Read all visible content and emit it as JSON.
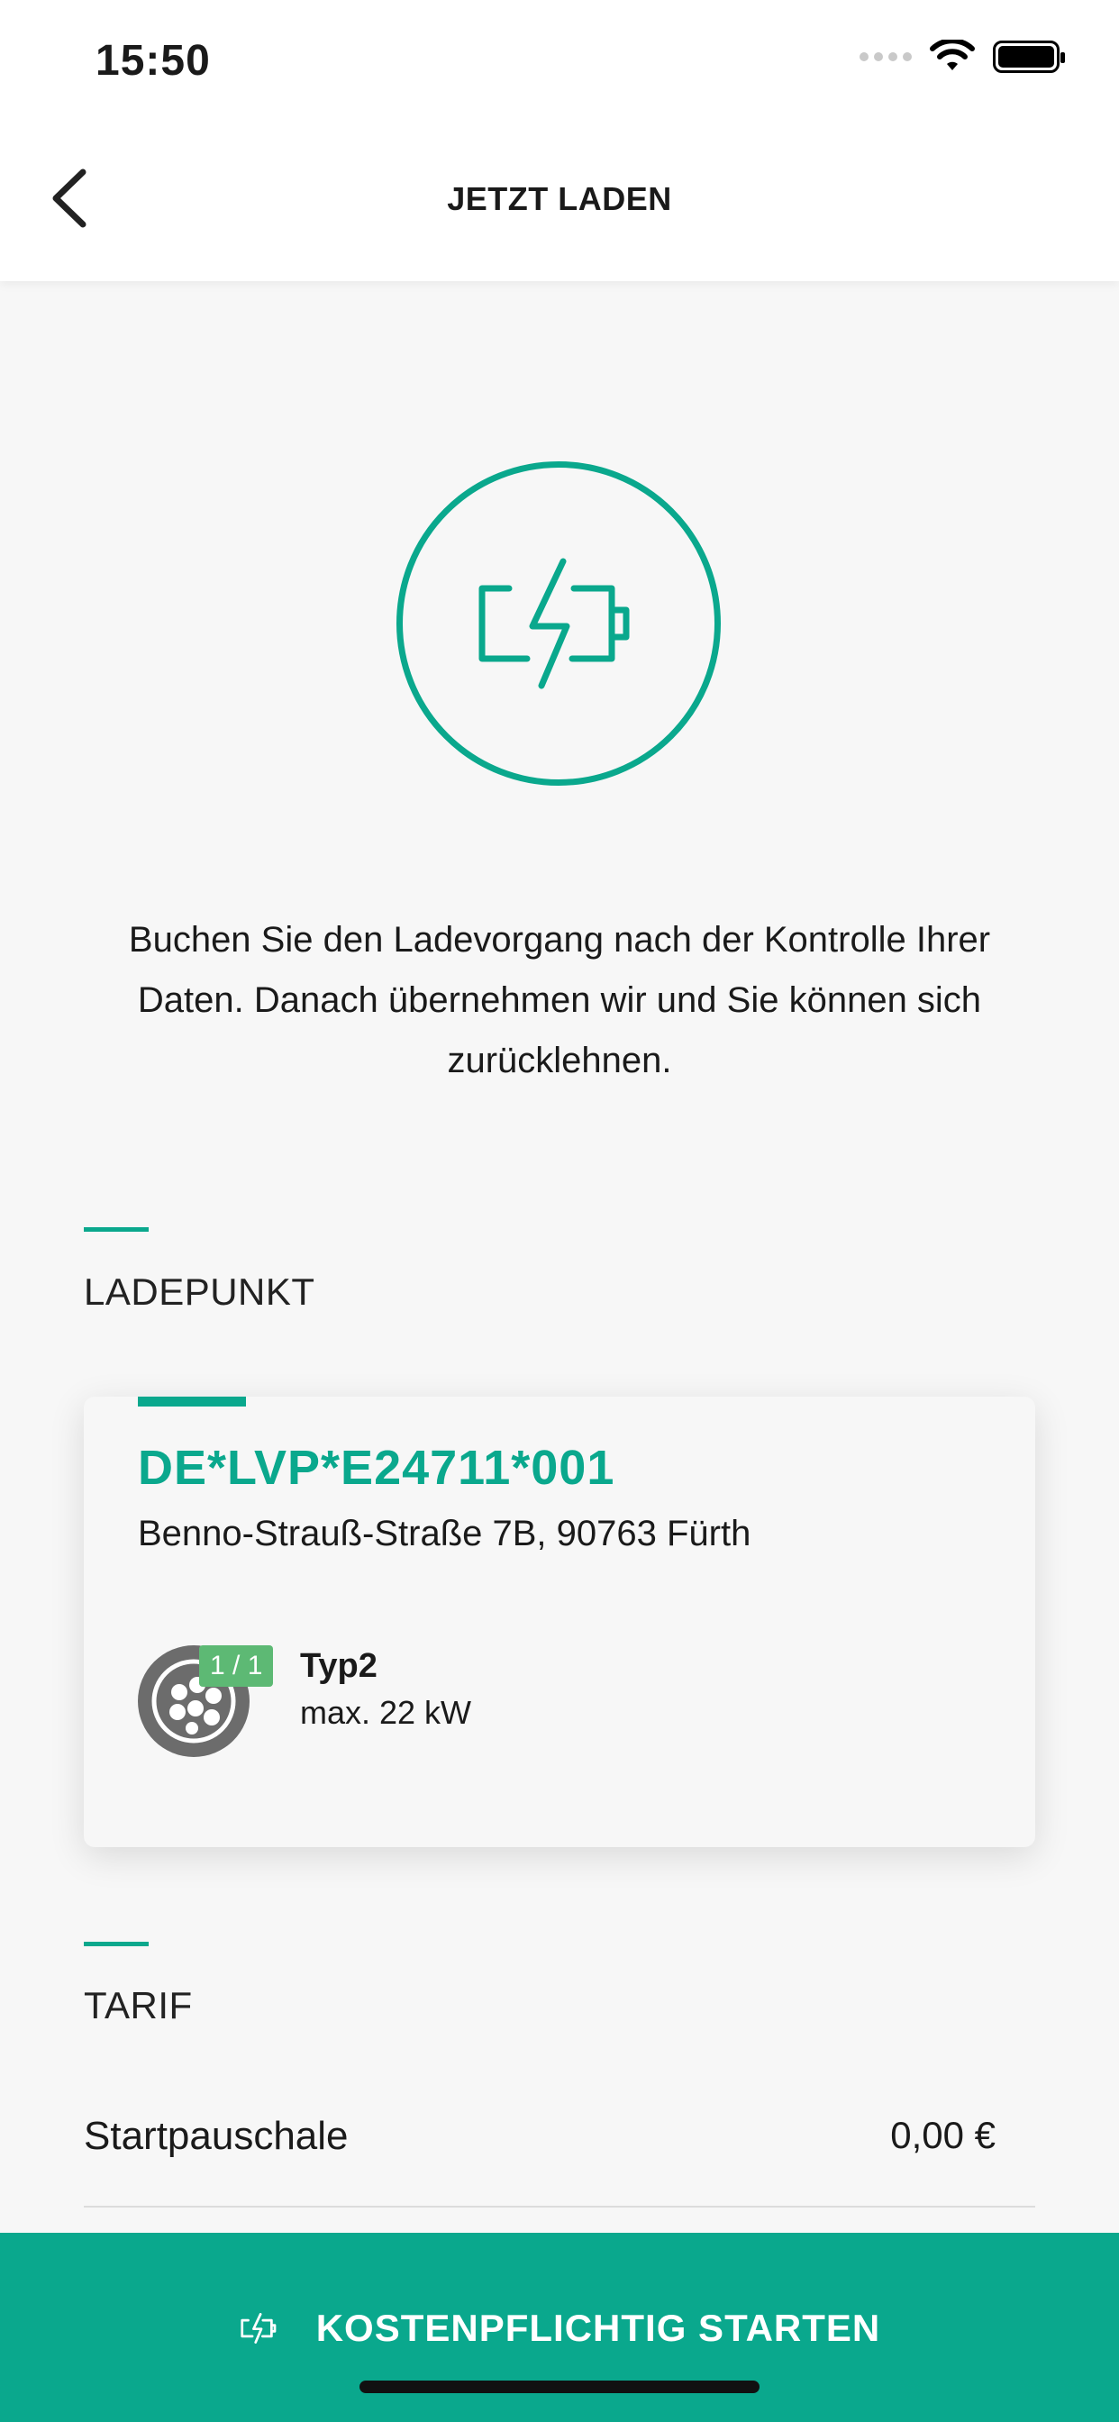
{
  "status_bar": {
    "time": "15:50"
  },
  "header": {
    "title": "JETZT LADEN"
  },
  "intro": {
    "text": "Buchen Sie den Ladevorgang nach der Kontrolle Ihrer Daten. Danach übernehmen wir und Sie können sich zurücklehnen."
  },
  "ladepunkt": {
    "section_label": "LADEPUNKT",
    "station_id": "DE*LVP*E24711*001",
    "address": "Benno-Strauß-Straße 7B, 90763 Fürth",
    "plug": {
      "badge": "1 / 1",
      "type": "Typ2",
      "power": "max. 22 kW"
    }
  },
  "tarif": {
    "section_label": "TARIF",
    "rows": [
      {
        "name": "Startpauschale",
        "value": "0,00 €"
      }
    ]
  },
  "cta": {
    "label": "KOSTENPFLICHTIG STARTEN"
  },
  "colors": {
    "accent": "#0aa88d",
    "badge": "#5db974",
    "plug": "#6c6c6c"
  }
}
